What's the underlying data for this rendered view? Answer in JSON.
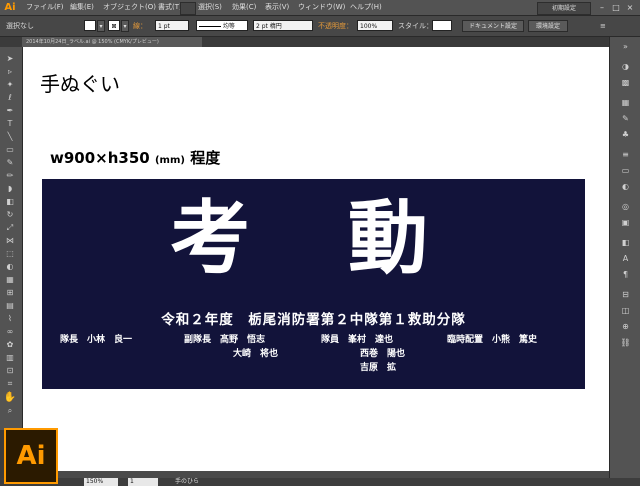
{
  "app": {
    "logo_small": "Ai",
    "logo_big": "Ai",
    "workspace": "初期設定",
    "menus": [
      "ファイル(F)",
      "編集(E)",
      "オブジェクト(O)",
      "書式(T)",
      "選択(S)",
      "効果(C)",
      "表示(V)",
      "ウィンドウ(W)",
      "ヘルプ(H)"
    ]
  },
  "controlbar": {
    "selection": "選択なし",
    "stroke_label": "線：",
    "stroke_value": "1 pt",
    "stroke_profile": "均等",
    "brush": "2 pt 楕円",
    "opacity_label": "不透明度：",
    "opacity_value": "100%",
    "style_label": "スタイル：",
    "doc_settings": "ドキュメント設定",
    "prefs": "環境設定"
  },
  "document": {
    "tab": "2014年10月24日_ラベル.ai @ 150% (CMYK/プレビュー)",
    "title": "手ぬぐい",
    "size_main": "w900×h350",
    "size_unit": "(mm)",
    "size_tail": "程度"
  },
  "towel": {
    "big_left": "考",
    "big_right": "動",
    "subtitle": "令和２年度　栃尾消防署第２中隊第１救助分隊",
    "members": {
      "m1": "隊長　小林　良一",
      "m2": "副隊長　髙野　悟志",
      "m3": "大崎　将也",
      "m4": "隊員　峯村　達也",
      "m5": "西巻　陽也",
      "m6": "吉原　拡",
      "m7": "臨時配置　小熊　篤史"
    },
    "colors": {
      "background": "#12133a",
      "text": "#ffffff"
    }
  },
  "status": {
    "zoom": "150%",
    "page": "1",
    "tool": "手のひら"
  }
}
